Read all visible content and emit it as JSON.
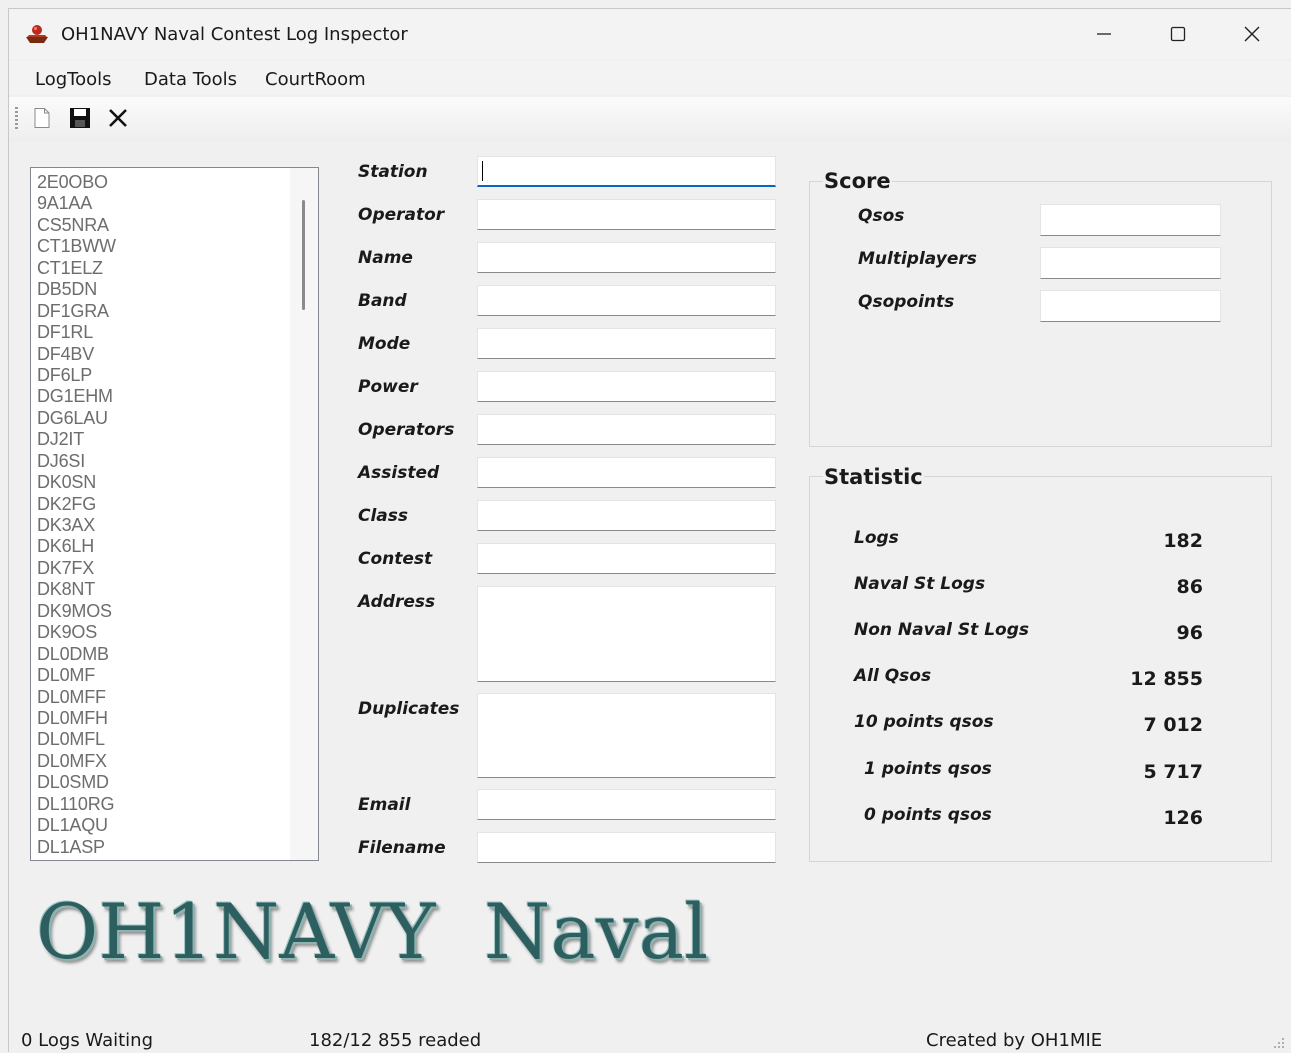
{
  "window": {
    "title": "OH1NAVY Naval Contest Log Inspector"
  },
  "menu": [
    "LogTools",
    "Data Tools",
    "CourtRoom"
  ],
  "toolbar": {
    "icons": [
      "new-document-icon",
      "save-icon",
      "close-icon"
    ]
  },
  "stations": [
    "2E0OBO",
    "9A1AA",
    "CS5NRA",
    "CT1BWW",
    "CT1ELZ",
    "DB5DN",
    "DF1GRA",
    "DF1RL",
    "DF4BV",
    "DF6LP",
    "DG1EHM",
    "DG6LAU",
    "DJ2IT",
    "DJ6SI",
    "DK0SN",
    "DK2FG",
    "DK3AX",
    "DK6LH",
    "DK7FX",
    "DK8NT",
    "DK9MOS",
    "DK9OS",
    "DL0DMB",
    "DL0MF",
    "DL0MFF",
    "DL0MFH",
    "DL0MFL",
    "DL0MFX",
    "DL0SMD",
    "DL110RG",
    "DL1AQU",
    "DL1ASP"
  ],
  "form": {
    "labels": [
      "Station",
      "Operator",
      "Name",
      "Band",
      "Mode",
      "Power",
      "Operators",
      "Assisted",
      "Class",
      "Contest",
      "Address",
      "Duplicates",
      "Email",
      "Filename"
    ]
  },
  "score": {
    "title": "Score",
    "labels": [
      "Qsos",
      "Multiplayers",
      "Qsopoints"
    ]
  },
  "statistic": {
    "title": "Statistic",
    "rows": [
      {
        "label": "Logs",
        "value": "182"
      },
      {
        "label": "Naval St Logs",
        "value": "86"
      },
      {
        "label": "Non Naval St Logs",
        "value": "96"
      },
      {
        "label": "All Qsos",
        "value": "12 855"
      },
      {
        "label": "10 points qsos",
        "value": "7 012"
      },
      {
        "label": "1 points qsos",
        "value": "5 717"
      },
      {
        "label": "0 points qsos",
        "value": "126"
      }
    ]
  },
  "logo": {
    "text": "OH1NAVY  Naval"
  },
  "status": {
    "waiting": "0 Logs Waiting",
    "readed": "182/12 855 readed",
    "credit": "Created by OH1MIE"
  },
  "colors": {
    "accent": "#0a64c8",
    "logo": "#2d5f60",
    "list_text": "#6d6d6d"
  }
}
